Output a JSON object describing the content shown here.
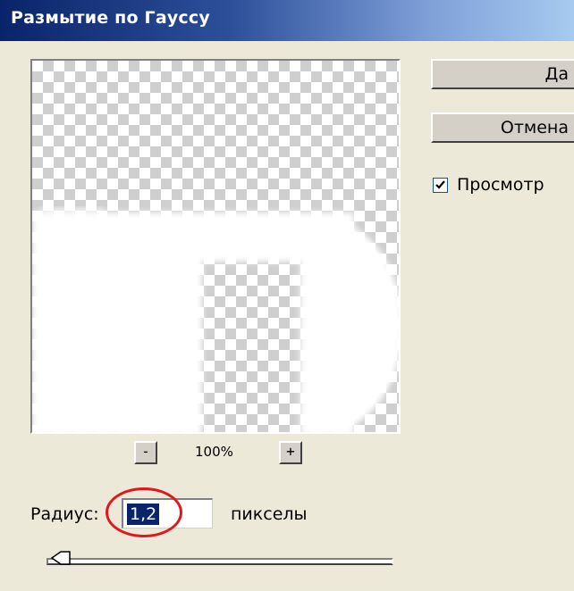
{
  "window": {
    "title": "Размытие по Гауссу"
  },
  "buttons": {
    "ok_label": "Да",
    "cancel_label": "Отмена"
  },
  "preview_toggle": {
    "label": "Просмотр",
    "checked": true
  },
  "zoom": {
    "minus_label": "-",
    "value": "100%",
    "plus_label": "+"
  },
  "radius": {
    "label": "Радиус:",
    "value": "1,2",
    "units": "пикселы"
  },
  "slider": {
    "value": 1.2
  },
  "colors": {
    "title_bar_start": "#0a246a",
    "title_bar_end": "#a6caf0",
    "dialog_bg": "#ece9d8",
    "selection_bg": "#0a246a",
    "highlight_ring": "#e0181e"
  }
}
